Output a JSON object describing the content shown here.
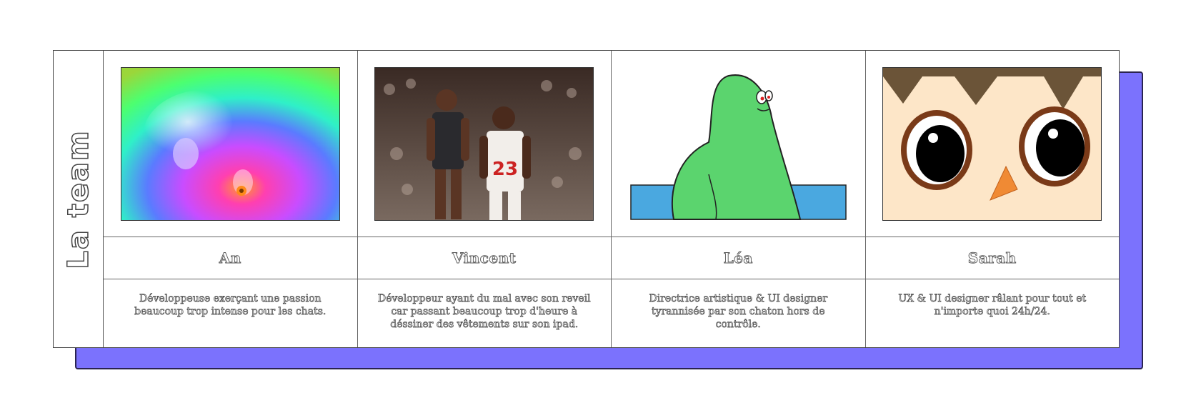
{
  "section_title": "La team",
  "members": [
    {
      "name": "An",
      "description": "Développeuse exerçant une passion beaucoup trop intense pour les chats.",
      "image": "psychedelic-cat-gif"
    },
    {
      "name": "Vincent",
      "description": "Développeur ayant du mal avec son reveil car passant beaucoup trop d'heure à déssiner des vêtements sur son ipad.",
      "image": "basketball-players-gif"
    },
    {
      "name": "Léa",
      "description": "Directrice artistique & UI designer tyrannisée par son chaton hors de contrôle.",
      "image": "green-blob-gif"
    },
    {
      "name": "Sarah",
      "description": "UX & UI designer râlant pour tout et n'importe quoi 24h/24.",
      "image": "villager-face-gif"
    }
  ],
  "colors": {
    "shadow": "#7b72fd",
    "blob_green": "#5bd46e",
    "water_blue": "#4aa8e0"
  }
}
